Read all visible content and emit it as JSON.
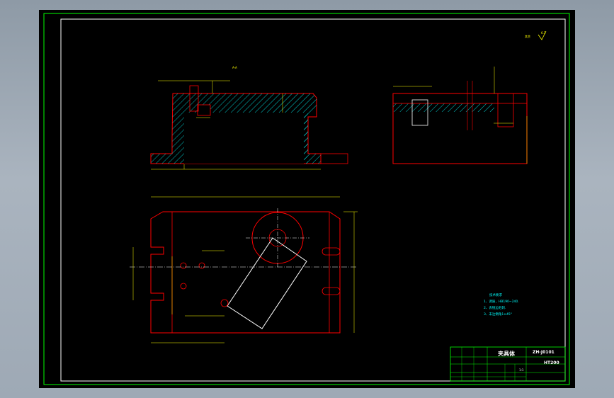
{
  "roughness": {
    "label": "其余",
    "value": "6.3"
  },
  "section": {
    "label": "A-A"
  },
  "tech_requirements": {
    "title": "技术要求",
    "items": [
      "1、调质，HB190~240.",
      "2、去锐边毛刺.",
      "3、未注倒角1×45°"
    ]
  },
  "title_block": {
    "part_name": "夹具体",
    "drawing_code": "ZH-J0101",
    "scale": "1:1",
    "material": "HT200"
  },
  "colors": {
    "frame": "#00ff00",
    "outline": "#ffffff",
    "hatch": "#00ffff",
    "dimension": "#ffff00",
    "section_red": "#ff0000",
    "background": "#000000"
  }
}
